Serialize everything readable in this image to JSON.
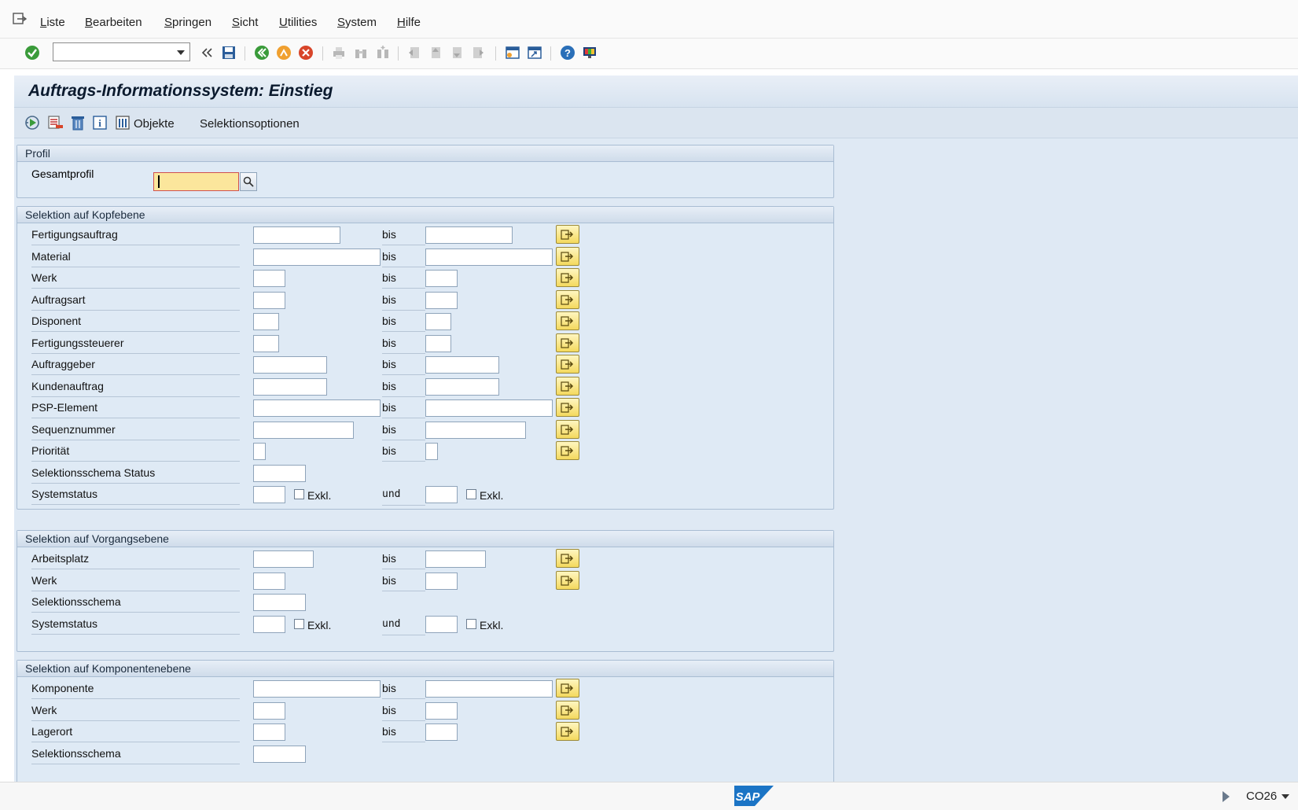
{
  "menubar": {
    "items": [
      "Liste",
      "Bearbeiten",
      "Springen",
      "Sicht",
      "Utilities",
      "System",
      "Hilfe"
    ]
  },
  "toolbar": {
    "command_field_value": ""
  },
  "screen": {
    "title": "Auftrags-Informationssystem: Einstieg"
  },
  "app_toolbar": {
    "objekte_label": "Objekte",
    "selektionsoptionen_label": "Selektionsoptionen"
  },
  "profil": {
    "header": "Profil",
    "gesamtprofil_label": "Gesamtprofil",
    "gesamtprofil_value": ""
  },
  "kopfebene": {
    "header": "Selektion auf Kopfebene",
    "rows": [
      {
        "label": "Fertigungsauftrag",
        "to_label": "bis"
      },
      {
        "label": "Material",
        "to_label": "bis"
      },
      {
        "label": "Werk",
        "to_label": "bis"
      },
      {
        "label": "Auftragsart",
        "to_label": "bis"
      },
      {
        "label": "Disponent",
        "to_label": "bis"
      },
      {
        "label": "Fertigungssteuerer",
        "to_label": "bis"
      },
      {
        "label": "Auftraggeber",
        "to_label": "bis"
      },
      {
        "label": "Kundenauftrag",
        "to_label": "bis"
      },
      {
        "label": "PSP-Element",
        "to_label": "bis"
      },
      {
        "label": "Sequenznummer",
        "to_label": "bis"
      },
      {
        "label": "Priorität",
        "to_label": "bis"
      },
      {
        "label": "Selektionsschema Status"
      },
      {
        "label": "Systemstatus",
        "exkl_label": "Exkl.",
        "and_label": "und",
        "exkl2_label": "Exkl."
      }
    ]
  },
  "vorgangsebene": {
    "header": "Selektion auf Vorgangsebene",
    "rows": [
      {
        "label": "Arbeitsplatz",
        "to_label": "bis"
      },
      {
        "label": "Werk",
        "to_label": "bis"
      },
      {
        "label": "Selektionsschema"
      },
      {
        "label": "Systemstatus",
        "exkl_label": "Exkl.",
        "and_label": "und",
        "exkl2_label": "Exkl."
      }
    ]
  },
  "komponentenebene": {
    "header": "Selektion auf Komponentenebene",
    "rows": [
      {
        "label": "Komponente",
        "to_label": "bis"
      },
      {
        "label": "Werk",
        "to_label": "bis"
      },
      {
        "label": "Lagerort",
        "to_label": "bis"
      },
      {
        "label": "Selektionsschema"
      }
    ]
  },
  "statusbar": {
    "logo_text": "SAP",
    "transaction": "CO26"
  }
}
